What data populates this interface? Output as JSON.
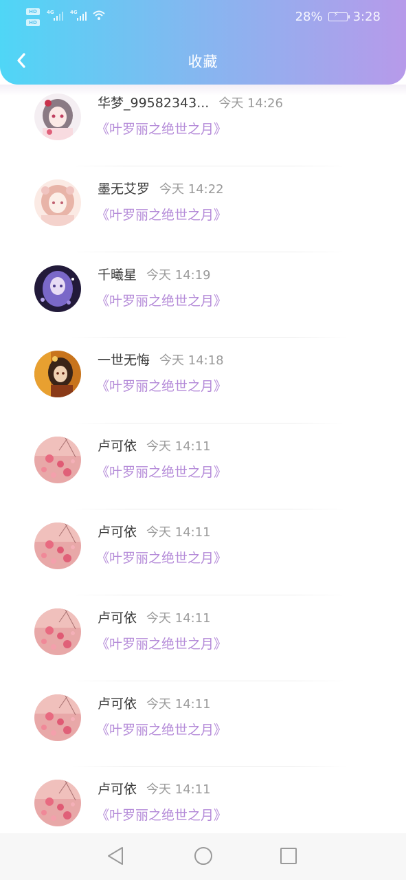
{
  "status_bar": {
    "hd1": "HD",
    "hd2": "HD",
    "net1": "4G",
    "net2": "4G",
    "battery": "28%",
    "time": "3:28"
  },
  "header": {
    "title": "收藏",
    "back_icon": "chevron-left-icon"
  },
  "colors": {
    "header_gradient_start": "#4fd6f6",
    "header_gradient_end": "#b79aea",
    "book_title": "#b48ad8"
  },
  "favorites": [
    {
      "name": "华梦_99582343...",
      "time": "今天 14:26",
      "book": "《叶罗丽之绝世之月》",
      "avatar": "anime-girl-white"
    },
    {
      "name": "墨无艾罗",
      "time": "今天 14:22",
      "book": "《叶罗丽之绝世之月》",
      "avatar": "anime-girl-pink"
    },
    {
      "name": "千曦星",
      "time": "今天 14:19",
      "book": "《叶罗丽之绝世之月》",
      "avatar": "anime-girl-purple"
    },
    {
      "name": "一世无悔",
      "time": "今天 14:18",
      "book": "《叶罗丽之绝世之月》",
      "avatar": "anime-girl-gold"
    },
    {
      "name": "卢可依",
      "time": "今天 14:11",
      "book": "《叶罗丽之绝世之月》",
      "avatar": "pink-flowers"
    },
    {
      "name": "卢可依",
      "time": "今天 14:11",
      "book": "《叶罗丽之绝世之月》",
      "avatar": "pink-flowers"
    },
    {
      "name": "卢可依",
      "time": "今天 14:11",
      "book": "《叶罗丽之绝世之月》",
      "avatar": "pink-flowers"
    },
    {
      "name": "卢可依",
      "time": "今天 14:11",
      "book": "《叶罗丽之绝世之月》",
      "avatar": "pink-flowers"
    },
    {
      "name": "卢可依",
      "time": "今天 14:11",
      "book": "《叶罗丽之绝世之月》",
      "avatar": "pink-flowers"
    }
  ],
  "navbar": {
    "back": "triangle-back-icon",
    "home": "circle-home-icon",
    "recents": "square-recents-icon"
  }
}
